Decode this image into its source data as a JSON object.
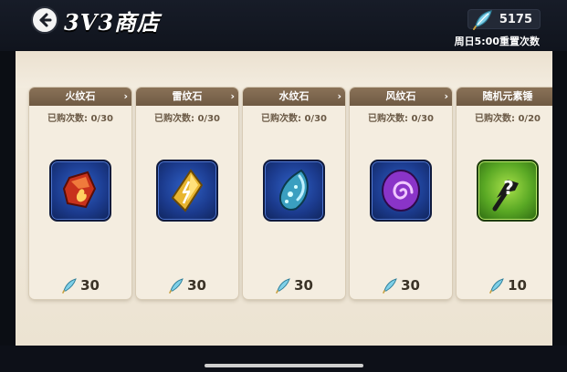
{
  "header": {
    "title": "3V3商店",
    "currency_amount": "5175",
    "reset_note": "周日5:00重置次数"
  },
  "items": [
    {
      "name": "火纹石",
      "bought": "已购次数: 0/30",
      "price": "30",
      "icon": "fire-stone-icon"
    },
    {
      "name": "雷纹石",
      "bought": "已购次数: 0/30",
      "price": "30",
      "icon": "thunder-stone-icon"
    },
    {
      "name": "水纹石",
      "bought": "已购次数: 0/30",
      "price": "30",
      "icon": "water-stone-icon"
    },
    {
      "name": "风纹石",
      "bought": "已购次数: 0/30",
      "price": "30",
      "icon": "wind-stone-icon"
    },
    {
      "name": "随机元素锤",
      "bought": "已购次数: 0/20",
      "price": "10",
      "icon": "random-hammer-icon"
    }
  ],
  "colors": {
    "card_header": "#7d6750",
    "panel": "#f0e8d9",
    "topbar": "#141925"
  }
}
